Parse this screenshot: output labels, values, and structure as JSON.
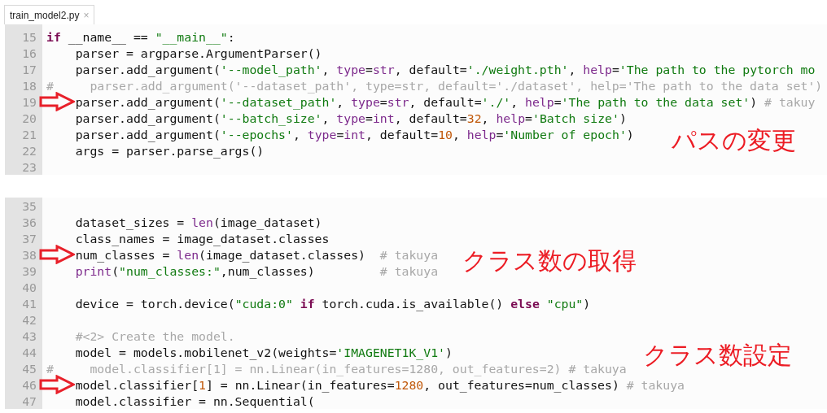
{
  "tabs": [
    {
      "label": "train_model2.py",
      "close": "×",
      "selected": true
    }
  ],
  "panels": [
    {
      "lines": [
        {
          "number": "15",
          "tokens": [
            {
              "kind": "kw",
              "text": "if"
            },
            {
              "kind": "plain",
              "text": " __name__ == "
            },
            {
              "kind": "str",
              "text": "\"__main__\""
            },
            {
              "kind": "plain",
              "text": ":"
            }
          ]
        },
        {
          "number": "16",
          "tokens": [
            {
              "kind": "plain",
              "text": "    parser = argparse.ArgumentParser()"
            }
          ]
        },
        {
          "number": "17",
          "tokens": [
            {
              "kind": "plain",
              "text": "    parser.add_argument("
            },
            {
              "kind": "str",
              "text": "'--model_path'"
            },
            {
              "kind": "plain",
              "text": ", "
            },
            {
              "kind": "fn",
              "text": "type"
            },
            {
              "kind": "plain",
              "text": "="
            },
            {
              "kind": "fn",
              "text": "str"
            },
            {
              "kind": "plain",
              "text": ", default="
            },
            {
              "kind": "str",
              "text": "'./weight.pth'"
            },
            {
              "kind": "plain",
              "text": ", "
            },
            {
              "kind": "fn",
              "text": "help"
            },
            {
              "kind": "plain",
              "text": "="
            },
            {
              "kind": "str",
              "text": "'The path to the pytorch mo"
            }
          ]
        },
        {
          "number": "18",
          "tokens": [
            {
              "kind": "com",
              "text": "#     parser.add_argument('--dataset_path', type=str, default='./dataset', help='The path to the data set')"
            }
          ]
        },
        {
          "number": "19",
          "marked": true,
          "tokens": [
            {
              "kind": "plain",
              "text": "    parser.add_argument("
            },
            {
              "kind": "str",
              "text": "'--dataset_path'"
            },
            {
              "kind": "plain",
              "text": ", "
            },
            {
              "kind": "fn",
              "text": "type"
            },
            {
              "kind": "plain",
              "text": "="
            },
            {
              "kind": "fn",
              "text": "str"
            },
            {
              "kind": "plain",
              "text": ", default="
            },
            {
              "kind": "str",
              "text": "'./'"
            },
            {
              "kind": "plain",
              "text": ", "
            },
            {
              "kind": "fn",
              "text": "help"
            },
            {
              "kind": "plain",
              "text": "="
            },
            {
              "kind": "str",
              "text": "'The path to the data set'"
            },
            {
              "kind": "plain",
              "text": ") "
            },
            {
              "kind": "com",
              "text": "# takuy"
            }
          ]
        },
        {
          "number": "20",
          "tokens": [
            {
              "kind": "plain",
              "text": "    parser.add_argument("
            },
            {
              "kind": "str",
              "text": "'--batch_size'"
            },
            {
              "kind": "plain",
              "text": ", "
            },
            {
              "kind": "fn",
              "text": "type"
            },
            {
              "kind": "plain",
              "text": "="
            },
            {
              "kind": "fn",
              "text": "int"
            },
            {
              "kind": "plain",
              "text": ", default="
            },
            {
              "kind": "num",
              "text": "32"
            },
            {
              "kind": "plain",
              "text": ", "
            },
            {
              "kind": "fn",
              "text": "help"
            },
            {
              "kind": "plain",
              "text": "="
            },
            {
              "kind": "str",
              "text": "'Batch size'"
            },
            {
              "kind": "plain",
              "text": ")"
            }
          ]
        },
        {
          "number": "21",
          "note": "パスの変更",
          "tokens": [
            {
              "kind": "plain",
              "text": "    parser.add_argument("
            },
            {
              "kind": "str",
              "text": "'--epochs'"
            },
            {
              "kind": "plain",
              "text": ", "
            },
            {
              "kind": "fn",
              "text": "type"
            },
            {
              "kind": "plain",
              "text": "="
            },
            {
              "kind": "fn",
              "text": "int"
            },
            {
              "kind": "plain",
              "text": ", default="
            },
            {
              "kind": "num",
              "text": "10"
            },
            {
              "kind": "plain",
              "text": ", "
            },
            {
              "kind": "fn",
              "text": "help"
            },
            {
              "kind": "plain",
              "text": "="
            },
            {
              "kind": "str",
              "text": "'Number of epoch'"
            },
            {
              "kind": "plain",
              "text": ")"
            }
          ]
        },
        {
          "number": "22",
          "tokens": [
            {
              "kind": "plain",
              "text": "    args = parser.parse_args()"
            }
          ]
        },
        {
          "number": "23"
        }
      ]
    },
    {
      "lines": [
        {
          "number": "35"
        },
        {
          "number": "36",
          "tokens": [
            {
              "kind": "plain",
              "text": "    dataset_sizes = "
            },
            {
              "kind": "fn",
              "text": "len"
            },
            {
              "kind": "plain",
              "text": "(image_dataset)"
            }
          ]
        },
        {
          "number": "37",
          "tokens": [
            {
              "kind": "plain",
              "text": "    class_names = image_dataset.classes"
            }
          ]
        },
        {
          "number": "38",
          "marked": true,
          "note": "クラス数の取得",
          "tokens": [
            {
              "kind": "plain",
              "text": "    num_classes = "
            },
            {
              "kind": "fn",
              "text": "len"
            },
            {
              "kind": "plain",
              "text": "(image_dataset.classes)  "
            },
            {
              "kind": "com",
              "text": "# takuya"
            }
          ]
        },
        {
          "number": "39",
          "tokens": [
            {
              "kind": "fn",
              "text": "    print"
            },
            {
              "kind": "plain",
              "text": "("
            },
            {
              "kind": "str",
              "text": "\"num_classes:\""
            },
            {
              "kind": "plain",
              "text": ",num_classes)         "
            },
            {
              "kind": "com",
              "text": "# takuya"
            }
          ]
        },
        {
          "number": "40"
        },
        {
          "number": "41",
          "tokens": [
            {
              "kind": "plain",
              "text": "    device = torch.device("
            },
            {
              "kind": "str",
              "text": "\"cuda:0\""
            },
            {
              "kind": "kw",
              "text": " if"
            },
            {
              "kind": "plain",
              "text": " torch.cuda.is_available() "
            },
            {
              "kind": "kw",
              "text": "else"
            },
            {
              "kind": "str",
              "text": " \"cpu\""
            },
            {
              "kind": "plain",
              "text": ")"
            }
          ]
        },
        {
          "number": "42"
        },
        {
          "number": "43",
          "tokens": [
            {
              "kind": "com",
              "text": "    #<2> Create the model."
            }
          ]
        },
        {
          "number": "44",
          "note": "クラス数設定",
          "tokens": [
            {
              "kind": "plain",
              "text": "    model = models.mobilenet_v2(weights="
            },
            {
              "kind": "str",
              "text": "'IMAGENET1K_V1'"
            },
            {
              "kind": "plain",
              "text": ")"
            }
          ]
        },
        {
          "number": "45",
          "tokens": [
            {
              "kind": "com",
              "text": "#     model.classifier[1] = nn.Linear(in_features=1280, out_features=2) # takuya"
            }
          ]
        },
        {
          "number": "46",
          "marked": true,
          "tokens": [
            {
              "kind": "plain",
              "text": "    model.classifier["
            },
            {
              "kind": "num",
              "text": "1"
            },
            {
              "kind": "plain",
              "text": "] = nn.Linear(in_features="
            },
            {
              "kind": "num",
              "text": "1280"
            },
            {
              "kind": "plain",
              "text": ", out_features=num_classes) "
            },
            {
              "kind": "com",
              "text": "# takuya"
            }
          ]
        },
        {
          "number": "47",
          "tokens": [
            {
              "kind": "plain",
              "text": "    model.classifier = nn.Sequential("
            }
          ]
        }
      ]
    }
  ]
}
